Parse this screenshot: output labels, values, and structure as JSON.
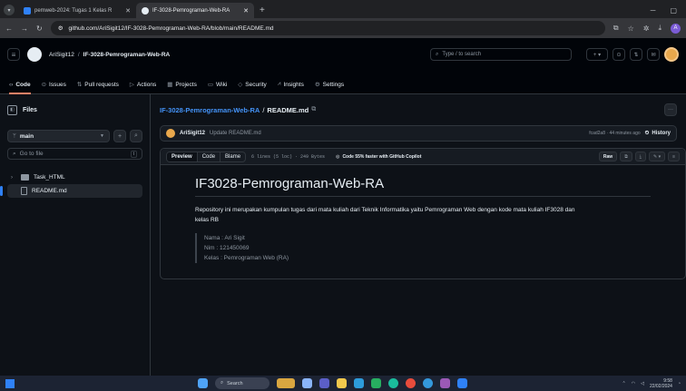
{
  "browser": {
    "tabs": [
      {
        "title": "pemweb-2024: Tugas 1 Kelas R",
        "active": false
      },
      {
        "title": "IF-3028-Pemrograman-Web-RA",
        "active": true
      }
    ],
    "new_tab": "+",
    "url": "github.com/AriSigit12/IF-3028-Pemrograman-Web-RA/blob/main/README.md"
  },
  "gh": {
    "owner": "AriSigit12",
    "repo": "IF-3028-Pemrograman-Web-RA",
    "search_placeholder": "Type / to search",
    "nav": [
      {
        "label": "Code",
        "icon": "code-icon",
        "active": true
      },
      {
        "label": "Issues",
        "icon": "issue-icon",
        "active": false
      },
      {
        "label": "Pull requests",
        "icon": "pull-request-icon",
        "active": false
      },
      {
        "label": "Actions",
        "icon": "play-icon",
        "active": false
      },
      {
        "label": "Projects",
        "icon": "table-icon",
        "active": false
      },
      {
        "label": "Wiki",
        "icon": "book-icon",
        "active": false
      },
      {
        "label": "Security",
        "icon": "shield-icon",
        "active": false
      },
      {
        "label": "Insights",
        "icon": "graph-icon",
        "active": false
      },
      {
        "label": "Settings",
        "icon": "gear-icon",
        "active": false
      }
    ]
  },
  "sidebar": {
    "title": "Files",
    "branch": "main",
    "goto_placeholder": "Go to file",
    "goto_shortcut": "t",
    "tree": [
      {
        "name": "Task_HTML",
        "type": "folder"
      },
      {
        "name": "README.md",
        "type": "file",
        "selected": true
      }
    ]
  },
  "main": {
    "path_repo": "IF-3028-Pemrograman-Web-RA",
    "path_sep": "/",
    "path_file": "README.md",
    "commit": {
      "user": "AriSigit12",
      "message": "Update README.md",
      "meta": "fcad2a8 · 44 minutes ago",
      "history": "History"
    },
    "toolbar": {
      "preview": "Preview",
      "code": "Code",
      "blame": "Blame",
      "stats": "6 lines (5 loc) · 249 Bytes",
      "copilot": "Code 55% faster with GitHub Copilot",
      "raw": "Raw"
    },
    "readme": {
      "heading": "IF3028-Pemrograman-Web-RA",
      "paragraph": "Repository ini merupakan kumpulan tugas dari mata kuliah dari Teknik Informatika yaitu Pemrograman Web dengan kode mata kuliah IF3028 dan kelas RB",
      "quote": [
        "Nama : Ari Sigit",
        "Nim : 121450069",
        "Kelas : Pemrograman Web (RA)"
      ]
    }
  },
  "taskbar": {
    "search": "Search",
    "time": "9:58",
    "date": "22/02/2024"
  },
  "colors": {
    "bg": "#0d1117",
    "header_bg": "#010409",
    "link": "#4493f8",
    "active_tab_underline": "#f78166",
    "accent": "#2f81f7"
  }
}
